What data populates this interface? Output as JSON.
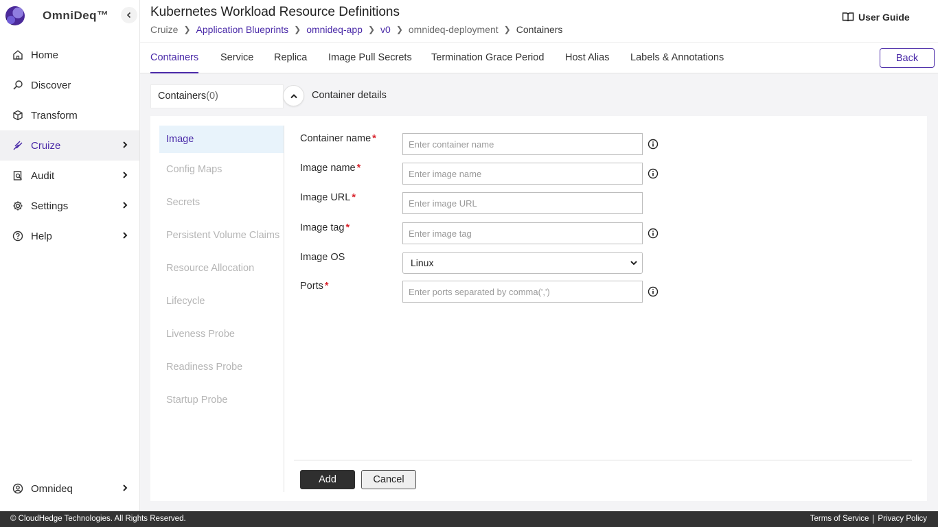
{
  "app": {
    "name": "OmniDeq™"
  },
  "sidebar": {
    "items": [
      {
        "label": "Home",
        "icon": "home-icon"
      },
      {
        "label": "Discover",
        "icon": "discover-icon"
      },
      {
        "label": "Transform",
        "icon": "cube-icon"
      },
      {
        "label": "Cruize",
        "icon": "cruize-icon",
        "active": true
      },
      {
        "label": "Audit",
        "icon": "audit-icon"
      },
      {
        "label": "Settings",
        "icon": "gear-icon"
      },
      {
        "label": "Help",
        "icon": "help-icon"
      }
    ],
    "user": {
      "label": "Omnideq",
      "icon": "user-icon"
    }
  },
  "header": {
    "title": "Kubernetes Workload Resource Definitions",
    "breadcrumb": [
      "Cruize",
      "Application Blueprints",
      "omnideq-app",
      "v0",
      "omnideq-deployment",
      "Containers"
    ],
    "user_guide": "User Guide"
  },
  "tabs": [
    "Containers",
    "Service",
    "Replica",
    "Image Pull Secrets",
    "Termination Grace Period",
    "Host Alias",
    "Labels & Annotations"
  ],
  "back_label": "Back",
  "containers_panel": {
    "label": "Containers",
    "count": "(0)",
    "details_title": "Container details"
  },
  "subnav": [
    "Image",
    "Config Maps",
    "Secrets",
    "Persistent Volume Claims",
    "Resource Allocation",
    "Lifecycle",
    "Liveness Probe",
    "Readiness Probe",
    "Startup Probe"
  ],
  "form": {
    "container_name": {
      "label": "Container name",
      "placeholder": "Enter container name"
    },
    "image_name": {
      "label": "Image name",
      "placeholder": "Enter image name"
    },
    "image_url": {
      "label": "Image URL",
      "placeholder": "Enter image URL"
    },
    "image_tag": {
      "label": "Image tag",
      "placeholder": "Enter image tag"
    },
    "image_os": {
      "label": "Image OS",
      "value": "Linux"
    },
    "ports": {
      "label": "Ports",
      "placeholder": "Enter ports separated by comma(',')"
    },
    "required_mark": "*"
  },
  "actions": {
    "add": "Add",
    "cancel": "Cancel"
  },
  "footer": {
    "copyright": "© CloudHedge Technologies. All Rights Reserved.",
    "terms": "Terms of Service",
    "privacy": "Privacy Policy"
  },
  "colors": {
    "accent": "#4a2aa8",
    "footer_bg": "#333333",
    "required": "#d9262f"
  }
}
